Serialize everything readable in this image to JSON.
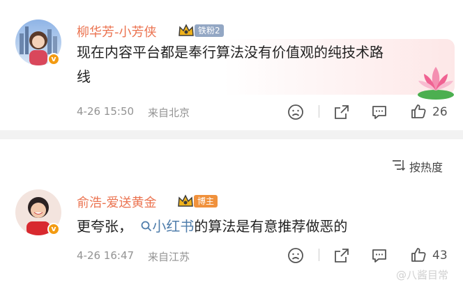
{
  "comments": [
    {
      "username": "柳华芳-小芳侠",
      "fan_badge": "铁粉2",
      "verified_mark": "v",
      "text": "现在内容平台都是奉行算法没有价值观的纯技术路线",
      "time": "4-26 15:50",
      "location": "来自北京",
      "likes": "26"
    },
    {
      "username": "俞浩-爱送黄金",
      "host_badge": "博主",
      "verified_mark": "v",
      "text_prefix": "更夸张，",
      "hashtag": "小红书",
      "text_suffix": "的算法是有意推荐做恶的",
      "time": "4-26 16:47",
      "location": "来自江苏",
      "likes": "43"
    }
  ],
  "sort": {
    "label": "按热度"
  },
  "watermark": "@八酱目常",
  "colors": {
    "username": "#eb7350",
    "hashtag": "#4f7dab",
    "meta": "#939393",
    "divider": "#f2f2f2",
    "verified": "#f39b12"
  },
  "icons": [
    "crown-icon",
    "sad-face-icon",
    "share-icon",
    "comment-icon",
    "thumbs-up-icon",
    "sort-icon",
    "search-icon",
    "lotus-sticker"
  ]
}
